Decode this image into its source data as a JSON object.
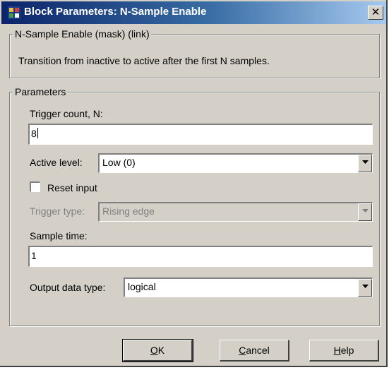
{
  "window": {
    "title": "Block Parameters: N-Sample Enable",
    "close_glyph": "✕"
  },
  "description_group": {
    "legend": "N-Sample Enable (mask) (link)",
    "text": "Transition from inactive to active after the first N samples."
  },
  "parameters": {
    "legend": "Parameters",
    "trigger_count": {
      "label": "Trigger count, N:",
      "value": "8"
    },
    "active_level": {
      "label": "Active level:",
      "value": "Low (0)"
    },
    "reset_input": {
      "label": "Reset input",
      "checked": false
    },
    "trigger_type": {
      "label": "Trigger type:",
      "value": "Rising edge",
      "enabled": false
    },
    "sample_time": {
      "label": "Sample time:",
      "value": "1"
    },
    "output_data_type": {
      "label": "Output data type:",
      "value": "logical"
    }
  },
  "buttons": {
    "ok": {
      "mnemonic": "O",
      "rest": "K"
    },
    "cancel": {
      "mnemonic": "C",
      "rest": "ancel"
    },
    "help": {
      "mnemonic": "H",
      "rest": "elp"
    }
  },
  "icons": {
    "app": "simulink-block-icon",
    "close": "close-icon",
    "dropdown": "chevron-down-icon"
  },
  "colors": {
    "titlebar_start": "#0a246a",
    "titlebar_end": "#a6caf0",
    "face": "#d4d0c8",
    "disabled_text": "#808080"
  }
}
